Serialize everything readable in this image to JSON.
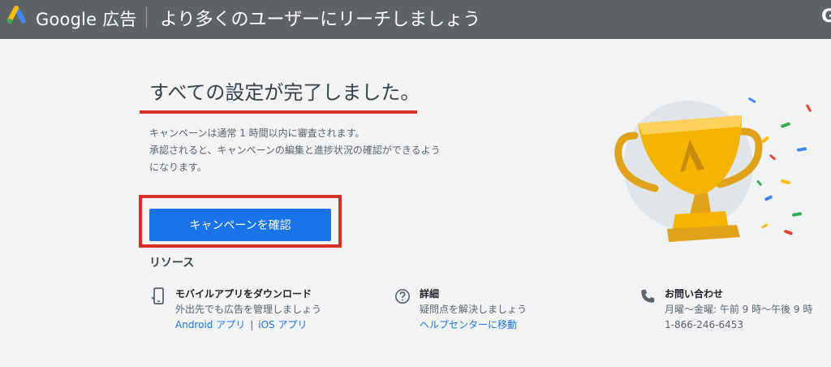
{
  "header": {
    "brand": "Google 広告",
    "title": "より多くのユーザーにリーチしましょう",
    "right_char": "G"
  },
  "main": {
    "heading": "すべての設定が完了しました。",
    "description": [
      "キャンペーンは通常 1 時間以内に審査されます。",
      "承認されると、キャンペーンの編集と進捗状況の確認ができるよう",
      "になります。"
    ],
    "primary_button": "キャンペーンを確認"
  },
  "resources": {
    "title": "リソース",
    "mobile": {
      "icon": "mobile-phone-icon",
      "title": "モバイルアプリをダウンロード",
      "subtitle": "外出先でも広告を管理しましょう",
      "android_link": "Android アプリ",
      "separator": "|",
      "ios_link": "iOS アプリ"
    },
    "details": {
      "icon": "help-circle-icon",
      "title": "詳細",
      "subtitle": "疑問点を解決しましょう",
      "link": "ヘルプセンターに移動"
    },
    "contact": {
      "icon": "phone-icon",
      "title": "お問い合わせ",
      "hours": "月曜〜金曜: 午前 9 時〜午後 9 時",
      "phone": "1-866-246-6453"
    }
  },
  "illustration": {
    "icon": "trophy-icon"
  },
  "colors": {
    "header_bg": "#5f6368",
    "page_bg": "#f1f3f4",
    "primary": "#1a73e8",
    "annotation_red": "#d93025",
    "trophy_gold": "#f4b400"
  }
}
